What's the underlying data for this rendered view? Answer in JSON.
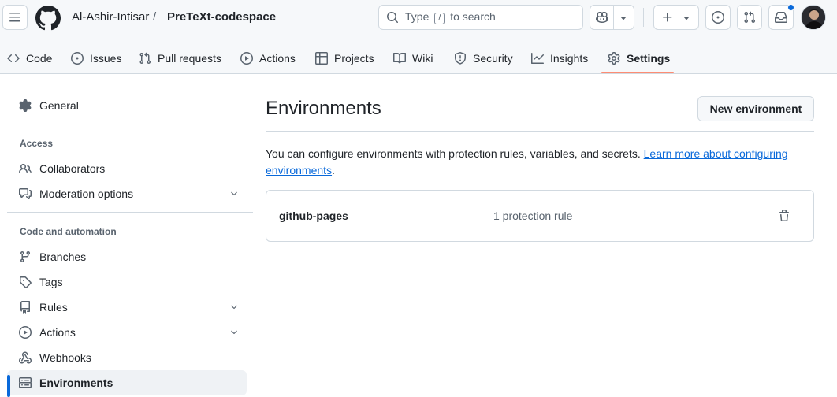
{
  "header": {
    "owner": "Al-Ashir-Intisar",
    "separator": "/",
    "repo": "PreTeXt-codespace",
    "search": {
      "prefix": "Type",
      "key": "/",
      "suffix": "to search"
    },
    "icons": [
      "menu-icon",
      "github-logo-icon",
      "search-icon",
      "copilot-icon",
      "plus-icon",
      "issue-opened-icon",
      "git-pull-request-icon",
      "inbox-icon"
    ]
  },
  "repo_nav": {
    "tabs": [
      {
        "label": "Code",
        "icon": "code-icon"
      },
      {
        "label": "Issues",
        "icon": "issue-opened-icon"
      },
      {
        "label": "Pull requests",
        "icon": "git-pull-request-icon"
      },
      {
        "label": "Actions",
        "icon": "play-icon"
      },
      {
        "label": "Projects",
        "icon": "table-icon"
      },
      {
        "label": "Wiki",
        "icon": "book-icon"
      },
      {
        "label": "Security",
        "icon": "shield-icon"
      },
      {
        "label": "Insights",
        "icon": "graph-icon"
      },
      {
        "label": "Settings",
        "icon": "gear-icon",
        "selected": true
      }
    ]
  },
  "sidebar": {
    "general": "General",
    "access_heading": "Access",
    "access_items": [
      "Collaborators",
      "Moderation options"
    ],
    "code_heading": "Code and automation",
    "code_items": [
      "Branches",
      "Tags",
      "Rules",
      "Actions",
      "Webhooks",
      "Environments"
    ],
    "active_item": "Environments"
  },
  "main": {
    "title": "Environments",
    "new_button": "New environment",
    "description": "You can configure environments with protection rules, variables, and secrets.",
    "learn_more_link": "Learn more about configuring environments",
    "environments": [
      {
        "name": "github-pages",
        "rules": "1 protection rule"
      }
    ]
  },
  "colors": {
    "accent": "#0969da",
    "tab_underline": "#fd8c73",
    "border": "#d1d9e0",
    "muted_text": "#59636e"
  }
}
